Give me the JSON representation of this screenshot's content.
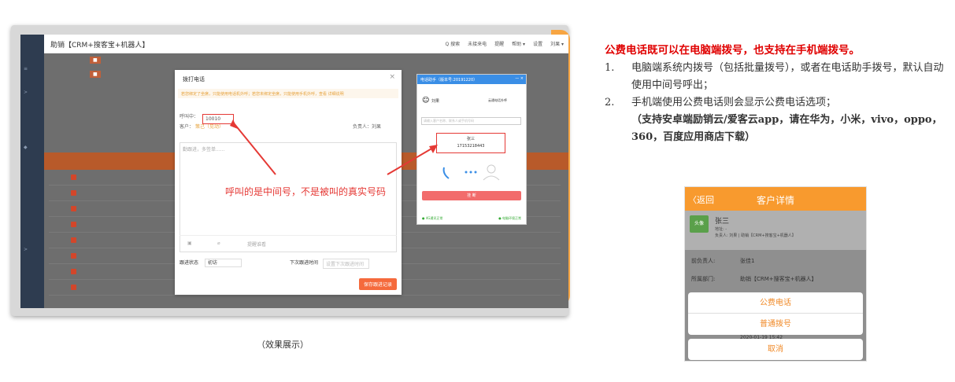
{
  "app": {
    "title": "助销【CRM+搜客宝+机器人】",
    "menu": [
      "Q 搜索",
      "未接来电",
      "提醒",
      "帮助 ▾",
      "设置",
      "刘果 ▾"
    ]
  },
  "dialog": {
    "title": "拨打电话",
    "close": "×",
    "notice": "若您绑定了坐席，只能使用电话机外呼；若您未绑定坐席，只能使用手机外呼，查看 详细说明",
    "caller_label": "呼叫中：",
    "caller_value": "10010",
    "customer_label": "客户：",
    "customer_value": "策己（见动）",
    "owner_label": "负责人：",
    "owner_value": "刘果",
    "placeholder": "勤跟进，多签单......",
    "attach": "提醒谁看",
    "status_label": "跟进状态",
    "status_value": "初访",
    "next_label": "下次跟进时间",
    "next_placeholder": "设置下次跟进时间",
    "save": "保存跟进记录"
  },
  "helper": {
    "title": "电话助手（版本号:20191220）",
    "user": "刘果",
    "mode": "云通电话外呼",
    "search_placeholder": "请输入客户名称、联系人或手机号码",
    "callee_name": "张三",
    "callee_number": "17153218443",
    "hangup": "挂 断",
    "foot_left": "● 4G通讯正常",
    "foot_right": "● 电脑环境正常"
  },
  "annotation": "呼叫的是中间号，不是被叫的真实号码",
  "caption": "（效果展示）",
  "right": {
    "title": "公费电话既可以在电脑端拨号，也支持在手机端拨号。",
    "items": [
      {
        "num": "1.",
        "text": "电脑端系统内拨号（包括批量拨号），或者在电话助手拨号，默认自动使用中间号呼出；"
      },
      {
        "num": "2.",
        "text": "手机端使用公费电话则会显示公费电话选项；"
      }
    ],
    "note": "（支持安卓端励销云/爱客云app，请在华为，小米，vivo，oppo，360，百度应用商店下载）"
  },
  "phone": {
    "back": "〈返回",
    "title": "客户详情",
    "avatar": "头像",
    "name": "张三",
    "sub1": "地址: -",
    "sub2": "负责人: 刘果 | 助销【CRM+搜客宝+机器人】",
    "row1_label": "前负责人:",
    "row1_value": "张佳1",
    "row2_label": "所属部门:",
    "row2_value": "助销【CRM+搜客宝+机器人】",
    "time": "2020-01-19 15:42",
    "opt_public": "公费电话",
    "opt_normal": "普通拨号",
    "opt_cancel": "取消"
  },
  "colors": {
    "accent": "#f89a2e",
    "red": "#e53935"
  }
}
